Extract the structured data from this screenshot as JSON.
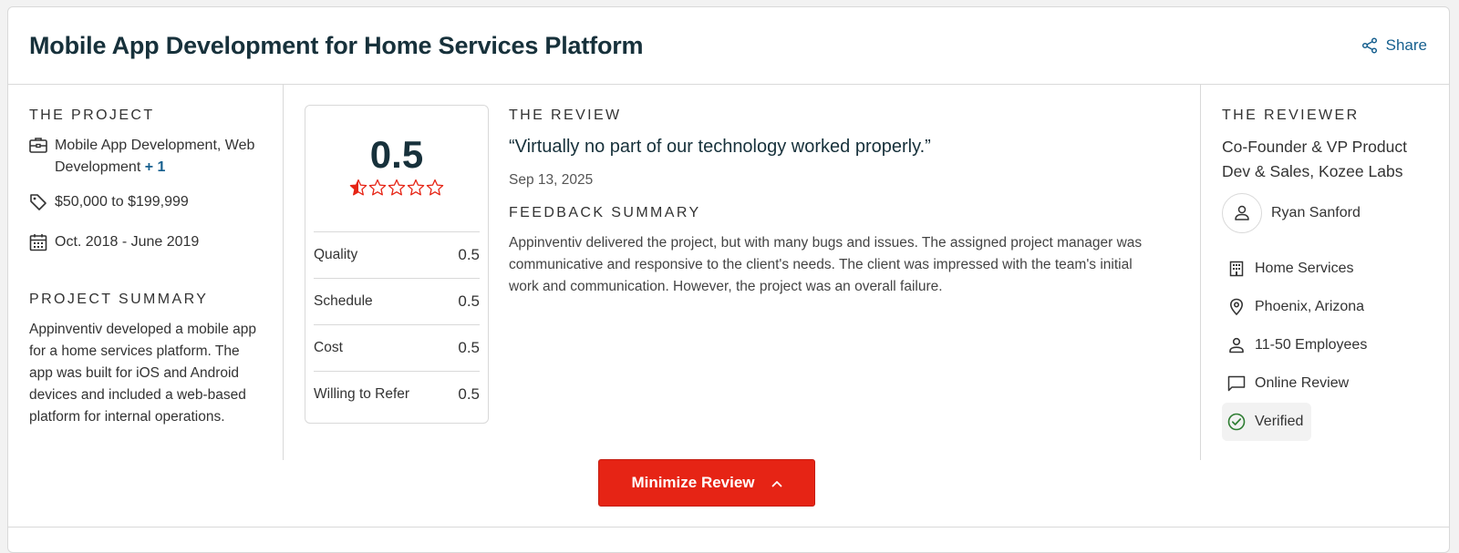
{
  "header": {
    "title": "Mobile App Development for Home Services Platform",
    "share_label": "Share"
  },
  "project": {
    "section_label": "THE PROJECT",
    "services": "Mobile App Development, Web Development",
    "services_more": "+ 1",
    "budget": "$50,000 to $199,999",
    "dates": "Oct. 2018 - June 2019",
    "summary_label": "PROJECT SUMMARY",
    "summary": "Appinventiv developed a mobile app for a home services platform. The app was built for iOS and Android devices and included a web-based platform for internal operations."
  },
  "rating": {
    "overall": "0.5",
    "stars_filled_fraction": 0.1,
    "rows": [
      {
        "label": "Quality",
        "value": "0.5"
      },
      {
        "label": "Schedule",
        "value": "0.5"
      },
      {
        "label": "Cost",
        "value": "0.5"
      },
      {
        "label": "Willing to Refer",
        "value": "0.5"
      }
    ]
  },
  "review": {
    "section_label": "THE REVIEW",
    "quote": "“Virtually no part of our technology worked properly.”",
    "date": "Sep 13, 2025",
    "feedback_label": "FEEDBACK SUMMARY",
    "feedback": "Appinventiv delivered the project, but with many bugs and issues. The assigned project manager was communicative and responsive to the client's needs. The client was impressed with the team's initial work and communication. However, the project was an overall failure."
  },
  "reviewer": {
    "section_label": "THE REVIEWER",
    "role": "Co-Founder & VP Product Dev & Sales, Kozee Labs",
    "name": "Ryan Sanford",
    "industry": "Home Services",
    "location": "Phoenix, Arizona",
    "size": "11-50 Employees",
    "review_type": "Online Review",
    "verified": "Verified"
  },
  "actions": {
    "minimize_label": "Minimize Review"
  },
  "colors": {
    "accent_red": "#e62415",
    "link_blue": "#17608f",
    "title_dark": "#17313b",
    "verified_green": "#2e7d32"
  }
}
